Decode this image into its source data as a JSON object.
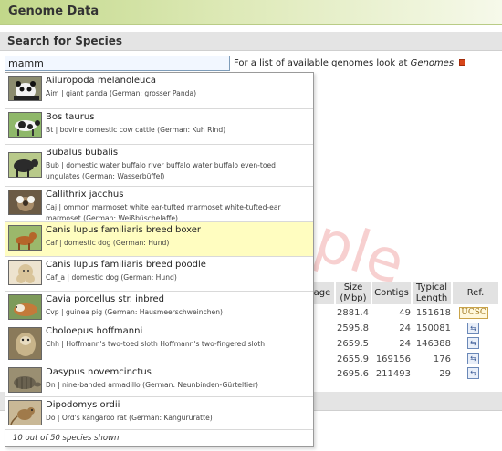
{
  "page": {
    "title": "Genome Data"
  },
  "search_section": {
    "heading": "Search for Species"
  },
  "search": {
    "value": "mamm"
  },
  "hint": {
    "text": "For a list of available genomes look at",
    "link": "Genomes"
  },
  "watermark": "ple",
  "table": {
    "headers": [
      "age",
      "Size (Mbp)",
      "Contigs",
      "Typical Length",
      "Ref."
    ],
    "rows": [
      {
        "size": "2881.4",
        "contigs": "49",
        "length": "151618",
        "ref": "UCSC"
      },
      {
        "size": "2595.8",
        "contigs": "24",
        "length": "150081",
        "ref": ""
      },
      {
        "size": "2659.5",
        "contigs": "24",
        "length": "146388",
        "ref": ""
      },
      {
        "size": "2655.9",
        "contigs": "169156",
        "length": "176",
        "ref": ""
      },
      {
        "size": "2695.6",
        "contigs": "211493",
        "length": "29",
        "ref": ""
      }
    ]
  },
  "dropdown": {
    "items": [
      {
        "name": "Ailuropoda melanoleuca",
        "desc": "Aim | giant panda (German: grosser Panda)",
        "highlight": false,
        "thumb": "panda-photo"
      },
      {
        "name": "Bos taurus",
        "desc": "Bt | bovine domestic cow cattle (German: Kuh Rind)",
        "highlight": false,
        "thumb": "cow-photo"
      },
      {
        "name": "Bubalus bubalis",
        "desc": "Bub | domestic water buffalo river buffalo water buffalo even-toed ungulates (German: Wasserbüffel)",
        "highlight": false,
        "thumb": "buffalo-photo"
      },
      {
        "name": "Callithrix jacchus",
        "desc": "Caj | ommon marmoset white ear-tufted marmoset white-tufted-ear marmoset (German: Weißbüschelaffe)",
        "highlight": false,
        "thumb": "marmoset-photo"
      },
      {
        "name": "Canis lupus familiaris breed boxer",
        "desc": "Caf | domestic dog (German: Hund)",
        "highlight": true,
        "thumb": "boxer-photo"
      },
      {
        "name": "Canis lupus familiaris breed poodle",
        "desc": "Caf_a | domestic dog (German: Hund)",
        "highlight": false,
        "thumb": "poodle-photo"
      },
      {
        "name": "Cavia porcellus str. inbred",
        "desc": "Cvp | guinea pig (German: Hausmeerschweinchen)",
        "highlight": false,
        "thumb": "guinea-pig-photo"
      },
      {
        "name": "Choloepus hoffmanni",
        "desc": "Chh | Hoffmann's two-toed sloth Hoffmann's two-fingered sloth",
        "highlight": false,
        "thumb": "sloth-photo"
      },
      {
        "name": "Dasypus novemcinctus",
        "desc": "Dn | nine-banded armadillo (German: Neunbinden-Gürteltier)",
        "highlight": false,
        "thumb": "armadillo-photo"
      },
      {
        "name": "Dipodomys ordii",
        "desc": "Do | Ord's kangaroo rat (German: Kängururatte)",
        "highlight": false,
        "thumb": "kangaroo-rat-photo"
      }
    ],
    "footer": "10 out of 50 species shown"
  },
  "colors": {
    "highlight": "#fffdc0",
    "title_bar": "#c2d88a",
    "section_bar": "#e4e4e4"
  }
}
